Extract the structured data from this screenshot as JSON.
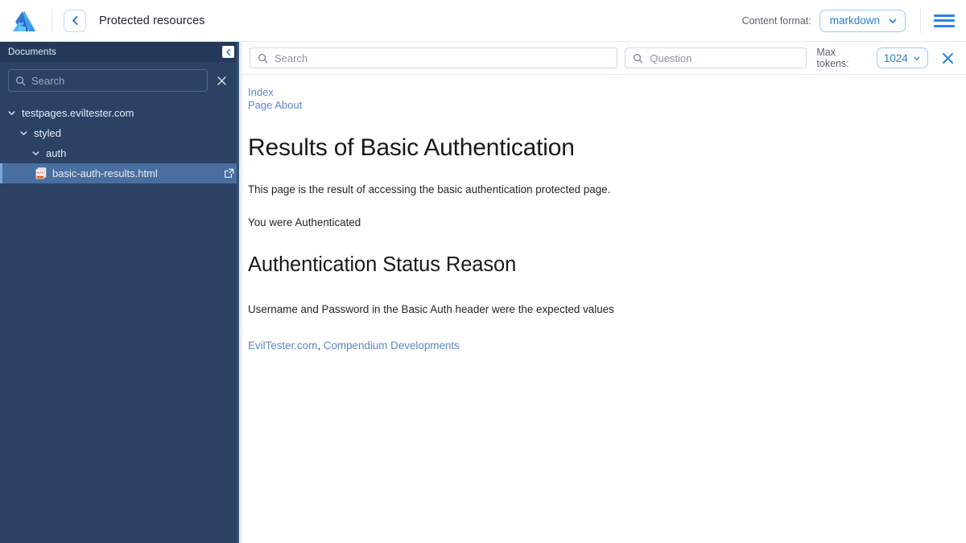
{
  "topbar": {
    "logo_icon": "azure-logo-icon",
    "back_icon": "chevron-left-icon",
    "title": "Protected resources",
    "content_format_label": "Content format:",
    "content_format_value": "markdown",
    "content_format_options": [
      "markdown"
    ],
    "menu_icon": "hamburger-menu-icon"
  },
  "sidebar": {
    "header_title": "Documents",
    "collapse_icon": "chevron-left-icon",
    "search": {
      "icon": "search-icon",
      "placeholder": "Search",
      "value": "",
      "clear_icon": "close-icon"
    },
    "tree": [
      {
        "label": "testpages.eviltester.com",
        "level": 0,
        "type": "folder",
        "expanded": true,
        "icon": "chevron-down-icon"
      },
      {
        "label": "styled",
        "level": 1,
        "type": "folder",
        "expanded": true,
        "icon": "chevron-down-icon"
      },
      {
        "label": "auth",
        "level": 2,
        "type": "folder",
        "expanded": true,
        "icon": "chevron-down-icon"
      },
      {
        "label": "basic-auth-results.html",
        "level": 3,
        "type": "file",
        "selected": true,
        "icon": "html-file-icon",
        "action_icon": "external-link-icon"
      }
    ]
  },
  "toolbar": {
    "search": {
      "icon": "search-icon",
      "placeholder": "Search",
      "value": ""
    },
    "question": {
      "icon": "search-icon",
      "placeholder": "Question",
      "value": ""
    },
    "max_tokens_label": "Max tokens:",
    "max_tokens_value": "1024",
    "max_tokens_options": [
      "1024"
    ],
    "close_icon": "close-icon"
  },
  "document": {
    "nav_links": [
      "Index",
      "Page About"
    ],
    "heading1": "Results of Basic Authentication",
    "paragraph1": "This page is the result of accessing the basic authentication protected page.",
    "paragraph2": "You were Authenticated",
    "heading2": "Authentication Status Reason",
    "paragraph3": "Username and Password in the Basic Auth header were the expected values",
    "footer_link1": "EvilTester.com",
    "footer_separator": ",",
    "footer_link2": "Compendium Developments"
  },
  "colors": {
    "sidebar_bg": "#2b4265",
    "sidebar_header_bg": "#253a5a",
    "selected_row_bg": "#4a6ea0",
    "accent_blue": "#2a84ea",
    "link_blue": "#5b87c7"
  }
}
